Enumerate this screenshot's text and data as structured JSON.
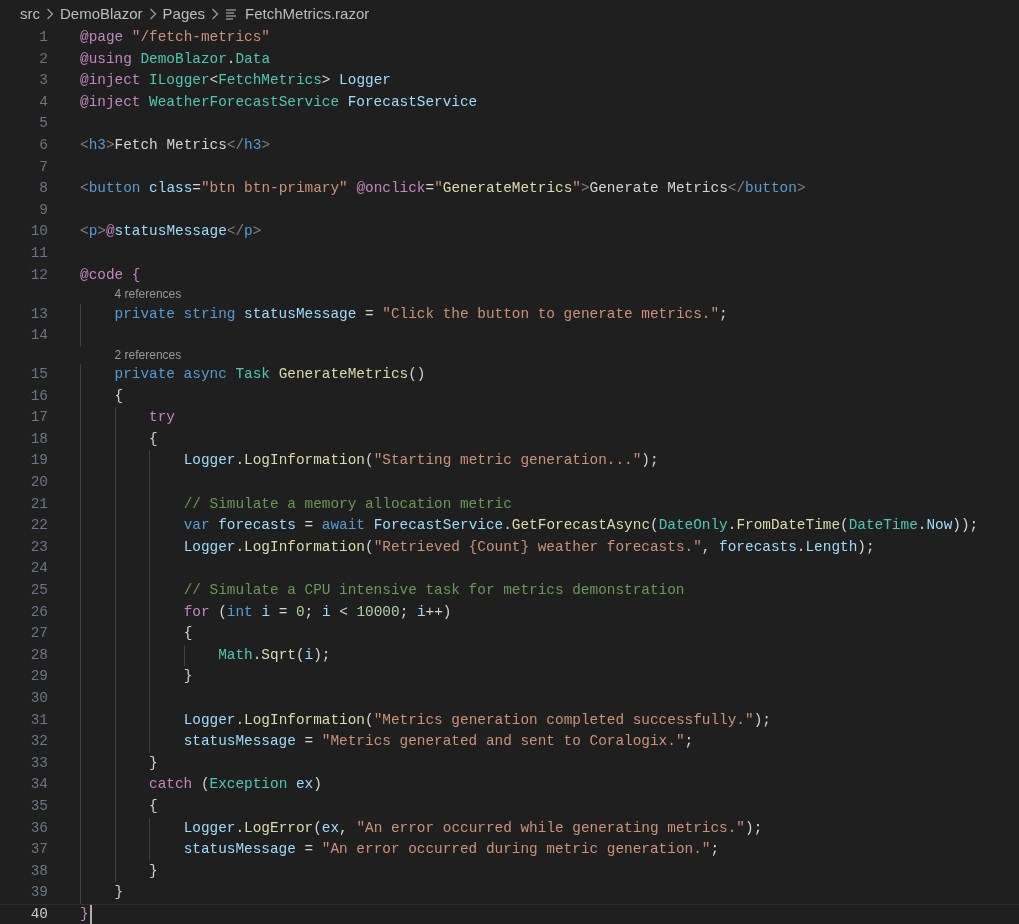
{
  "breadcrumb": [
    {
      "text": "src",
      "kind": "folder"
    },
    {
      "text": "DemoBlazor",
      "kind": "folder"
    },
    {
      "text": "Pages",
      "kind": "folder"
    },
    {
      "text": "FetchMetrics.razor",
      "kind": "file"
    }
  ],
  "lines": [
    {
      "kind": "code",
      "number": "1",
      "cursor": false,
      "tokens": [
        {
          "kind": "ctl",
          "text": "@page"
        },
        {
          "kind": "str",
          "text": " \"/fetch-metrics\""
        }
      ]
    },
    {
      "kind": "code",
      "number": "2",
      "cursor": false,
      "tokens": [
        {
          "kind": "ctl",
          "text": "@using"
        },
        {
          "kind": "type",
          "text": " DemoBlazor"
        },
        {
          "kind": "pun",
          "text": "."
        },
        {
          "kind": "type",
          "text": "Data"
        }
      ]
    },
    {
      "kind": "code",
      "number": "3",
      "cursor": false,
      "tokens": [
        {
          "kind": "ctl",
          "text": "@inject"
        },
        {
          "kind": "type",
          "text": " ILogger"
        },
        {
          "kind": "pun",
          "text": "<"
        },
        {
          "kind": "type",
          "text": "FetchMetrics"
        },
        {
          "kind": "pun",
          "text": "> "
        },
        {
          "kind": "var",
          "text": "Logger"
        }
      ]
    },
    {
      "kind": "code",
      "number": "4",
      "cursor": false,
      "tokens": [
        {
          "kind": "ctl",
          "text": "@inject"
        },
        {
          "kind": "type",
          "text": " WeatherForecastService"
        },
        {
          "kind": "var",
          "text": " ForecastService"
        }
      ]
    },
    {
      "kind": "code",
      "number": "5",
      "cursor": false
    },
    {
      "kind": "code",
      "number": "6",
      "cursor": false,
      "tokens": [
        {
          "kind": "tag",
          "text": "<"
        },
        {
          "kind": "kw",
          "text": "h3"
        },
        {
          "kind": "tag",
          "text": ">"
        },
        {
          "kind": "txt",
          "text": "Fetch Metrics"
        },
        {
          "kind": "tag",
          "text": "</"
        },
        {
          "kind": "kw",
          "text": "h3"
        },
        {
          "kind": "tag",
          "text": ">"
        }
      ]
    },
    {
      "kind": "code",
      "number": "7",
      "cursor": false
    },
    {
      "kind": "code",
      "number": "8",
      "cursor": false,
      "tokens": [
        {
          "kind": "tag",
          "text": "<"
        },
        {
          "kind": "kw",
          "text": "button"
        },
        {
          "kind": "var",
          "text": " class"
        },
        {
          "kind": "pun",
          "text": "="
        },
        {
          "kind": "str",
          "text": "\"btn btn-primary\""
        },
        {
          "kind": "ctl",
          "text": " @onclick"
        },
        {
          "kind": "pun",
          "text": "="
        },
        {
          "kind": "str",
          "text": "\""
        },
        {
          "kind": "fn",
          "text": "GenerateMetrics"
        },
        {
          "kind": "str",
          "text": "\""
        },
        {
          "kind": "tag",
          "text": ">"
        },
        {
          "kind": "txt",
          "text": "Generate Metrics"
        },
        {
          "kind": "tag",
          "text": "</"
        },
        {
          "kind": "kw",
          "text": "button"
        },
        {
          "kind": "tag",
          "text": ">"
        }
      ]
    },
    {
      "kind": "code",
      "number": "9",
      "cursor": false
    },
    {
      "kind": "code",
      "number": "10",
      "cursor": false,
      "tokens": [
        {
          "kind": "tag",
          "text": "<"
        },
        {
          "kind": "kw",
          "text": "p"
        },
        {
          "kind": "tag",
          "text": ">"
        },
        {
          "kind": "ctl",
          "text": "@"
        },
        {
          "kind": "var",
          "text": "statusMessage"
        },
        {
          "kind": "tag",
          "text": "</"
        },
        {
          "kind": "kw",
          "text": "p"
        },
        {
          "kind": "tag",
          "text": ">"
        }
      ]
    },
    {
      "kind": "code",
      "number": "11",
      "cursor": false
    },
    {
      "kind": "code",
      "number": "12",
      "cursor": false,
      "tokens": [
        {
          "kind": "ctl",
          "text": "@code {"
        }
      ]
    },
    {
      "kind": "codelens",
      "text": "4 references"
    },
    {
      "kind": "code",
      "number": "13",
      "cursor": false,
      "tokens": [
        {
          "kind": "kw",
          "text": "    private"
        },
        {
          "kind": "kw",
          "text": " string"
        },
        {
          "kind": "var",
          "text": " statusMessage"
        },
        {
          "kind": "pun",
          "text": " = "
        },
        {
          "kind": "str",
          "text": "\"Click the button to generate metrics.\""
        },
        {
          "kind": "pun",
          "text": ";"
        }
      ]
    },
    {
      "kind": "code",
      "number": "14",
      "cursor": false
    },
    {
      "kind": "codelens",
      "text": "2 references"
    },
    {
      "kind": "code",
      "number": "15",
      "cursor": false,
      "tokens": [
        {
          "kind": "kw",
          "text": "    private"
        },
        {
          "kind": "kw",
          "text": " async"
        },
        {
          "kind": "type",
          "text": " Task"
        },
        {
          "kind": "fn",
          "text": " GenerateMetrics"
        },
        {
          "kind": "pun",
          "text": "()"
        }
      ]
    },
    {
      "kind": "code",
      "number": "16",
      "cursor": false,
      "tokens": [
        {
          "kind": "pun",
          "text": "    {"
        }
      ]
    },
    {
      "kind": "code",
      "number": "17",
      "cursor": false,
      "tokens": [
        {
          "kind": "ctl",
          "text": "        try"
        }
      ]
    },
    {
      "kind": "code",
      "number": "18",
      "cursor": false,
      "tokens": [
        {
          "kind": "pun",
          "text": "        {"
        }
      ]
    },
    {
      "kind": "code",
      "number": "19",
      "cursor": false,
      "tokens": [
        {
          "kind": "var",
          "text": "            Logger"
        },
        {
          "kind": "pun",
          "text": "."
        },
        {
          "kind": "fn",
          "text": "LogInformation"
        },
        {
          "kind": "pun",
          "text": "("
        },
        {
          "kind": "str",
          "text": "\"Starting metric generation...\""
        },
        {
          "kind": "pun",
          "text": ");"
        }
      ]
    },
    {
      "kind": "code",
      "number": "20",
      "cursor": false
    },
    {
      "kind": "code",
      "number": "21",
      "cursor": false,
      "tokens": [
        {
          "kind": "com",
          "text": "            // Simulate a memory allocation metric"
        }
      ]
    },
    {
      "kind": "code",
      "number": "22",
      "cursor": false,
      "tokens": [
        {
          "kind": "kw",
          "text": "            var"
        },
        {
          "kind": "var",
          "text": " forecasts"
        },
        {
          "kind": "pun",
          "text": " = "
        },
        {
          "kind": "kw",
          "text": "await "
        },
        {
          "kind": "var",
          "text": "ForecastService"
        },
        {
          "kind": "pun",
          "text": "."
        },
        {
          "kind": "fn",
          "text": "GetForecastAsync"
        },
        {
          "kind": "pun",
          "text": "("
        },
        {
          "kind": "type",
          "text": "DateOnly"
        },
        {
          "kind": "pun",
          "text": "."
        },
        {
          "kind": "fn",
          "text": "FromDateTime"
        },
        {
          "kind": "pun",
          "text": "("
        },
        {
          "kind": "type",
          "text": "DateTime"
        },
        {
          "kind": "pun",
          "text": "."
        },
        {
          "kind": "var",
          "text": "Now"
        },
        {
          "kind": "pun",
          "text": "));"
        }
      ]
    },
    {
      "kind": "code",
      "number": "23",
      "cursor": false,
      "tokens": [
        {
          "kind": "var",
          "text": "            Logger"
        },
        {
          "kind": "pun",
          "text": "."
        },
        {
          "kind": "fn",
          "text": "LogInformation"
        },
        {
          "kind": "pun",
          "text": "("
        },
        {
          "kind": "str",
          "text": "\"Retrieved {Count} weather forecasts.\""
        },
        {
          "kind": "pun",
          "text": ", "
        },
        {
          "kind": "var",
          "text": "forecasts"
        },
        {
          "kind": "pun",
          "text": "."
        },
        {
          "kind": "var",
          "text": "Length"
        },
        {
          "kind": "pun",
          "text": ");"
        }
      ]
    },
    {
      "kind": "code",
      "number": "24",
      "cursor": false
    },
    {
      "kind": "code",
      "number": "25",
      "cursor": false,
      "tokens": [
        {
          "kind": "com",
          "text": "            // Simulate a CPU intensive task for metrics demonstration"
        }
      ]
    },
    {
      "kind": "code",
      "number": "26",
      "cursor": false,
      "tokens": [
        {
          "kind": "ctl",
          "text": "            for"
        },
        {
          "kind": "pun",
          "text": " ("
        },
        {
          "kind": "kw",
          "text": "int"
        },
        {
          "kind": "var",
          "text": " i"
        },
        {
          "kind": "pun",
          "text": " = "
        },
        {
          "kind": "num",
          "text": "0"
        },
        {
          "kind": "pun",
          "text": "; "
        },
        {
          "kind": "var",
          "text": "i"
        },
        {
          "kind": "pun",
          "text": " < "
        },
        {
          "kind": "num",
          "text": "10000"
        },
        {
          "kind": "pun",
          "text": "; "
        },
        {
          "kind": "var",
          "text": "i"
        },
        {
          "kind": "pun",
          "text": "++)"
        }
      ]
    },
    {
      "kind": "code",
      "number": "27",
      "cursor": false,
      "tokens": [
        {
          "kind": "pun",
          "text": "            {"
        }
      ]
    },
    {
      "kind": "code",
      "number": "28",
      "cursor": false,
      "tokens": [
        {
          "kind": "type",
          "text": "                Math"
        },
        {
          "kind": "pun",
          "text": "."
        },
        {
          "kind": "fn",
          "text": "Sqrt"
        },
        {
          "kind": "pun",
          "text": "("
        },
        {
          "kind": "var",
          "text": "i"
        },
        {
          "kind": "pun",
          "text": ");"
        }
      ]
    },
    {
      "kind": "code",
      "number": "29",
      "cursor": false,
      "tokens": [
        {
          "kind": "pun",
          "text": "            }"
        }
      ]
    },
    {
      "kind": "code",
      "number": "30",
      "cursor": false
    },
    {
      "kind": "code",
      "number": "31",
      "cursor": false,
      "tokens": [
        {
          "kind": "var",
          "text": "            Logger"
        },
        {
          "kind": "pun",
          "text": "."
        },
        {
          "kind": "fn",
          "text": "LogInformation"
        },
        {
          "kind": "pun",
          "text": "("
        },
        {
          "kind": "str",
          "text": "\"Metrics generation completed successfully.\""
        },
        {
          "kind": "pun",
          "text": ");"
        }
      ]
    },
    {
      "kind": "code",
      "number": "32",
      "cursor": false,
      "tokens": [
        {
          "kind": "var",
          "text": "            statusMessage"
        },
        {
          "kind": "pun",
          "text": " = "
        },
        {
          "kind": "str",
          "text": "\"Metrics generated and sent to Coralogix.\""
        },
        {
          "kind": "pun",
          "text": ";"
        }
      ]
    },
    {
      "kind": "code",
      "number": "33",
      "cursor": false,
      "tokens": [
        {
          "kind": "pun",
          "text": "        }"
        }
      ]
    },
    {
      "kind": "code",
      "number": "34",
      "cursor": false,
      "tokens": [
        {
          "kind": "ctl",
          "text": "        catch"
        },
        {
          "kind": "pun",
          "text": " ("
        },
        {
          "kind": "type",
          "text": "Exception"
        },
        {
          "kind": "var",
          "text": " ex"
        },
        {
          "kind": "pun",
          "text": ")"
        }
      ]
    },
    {
      "kind": "code",
      "number": "35",
      "cursor": false,
      "tokens": [
        {
          "kind": "pun",
          "text": "        {"
        }
      ]
    },
    {
      "kind": "code",
      "number": "36",
      "cursor": false,
      "tokens": [
        {
          "kind": "var",
          "text": "            Logger"
        },
        {
          "kind": "pun",
          "text": "."
        },
        {
          "kind": "fn",
          "text": "LogError"
        },
        {
          "kind": "pun",
          "text": "("
        },
        {
          "kind": "var",
          "text": "ex"
        },
        {
          "kind": "pun",
          "text": ", "
        },
        {
          "kind": "str",
          "text": "\"An error occurred while generating metrics.\""
        },
        {
          "kind": "pun",
          "text": ");"
        }
      ]
    },
    {
      "kind": "code",
      "number": "37",
      "cursor": false,
      "tokens": [
        {
          "kind": "var",
          "text": "            statusMessage"
        },
        {
          "kind": "pun",
          "text": " = "
        },
        {
          "kind": "str",
          "text": "\"An error occurred during metric generation.\""
        },
        {
          "kind": "pun",
          "text": ";"
        }
      ]
    },
    {
      "kind": "code",
      "number": "38",
      "cursor": false,
      "tokens": [
        {
          "kind": "pun",
          "text": "        }"
        }
      ]
    },
    {
      "kind": "code",
      "number": "39",
      "cursor": false,
      "tokens": [
        {
          "kind": "pun",
          "text": "    }"
        }
      ]
    },
    {
      "kind": "code",
      "number": "40",
      "cursor": true,
      "tokens": [
        {
          "kind": "ctl",
          "text": "}"
        }
      ]
    }
  ]
}
